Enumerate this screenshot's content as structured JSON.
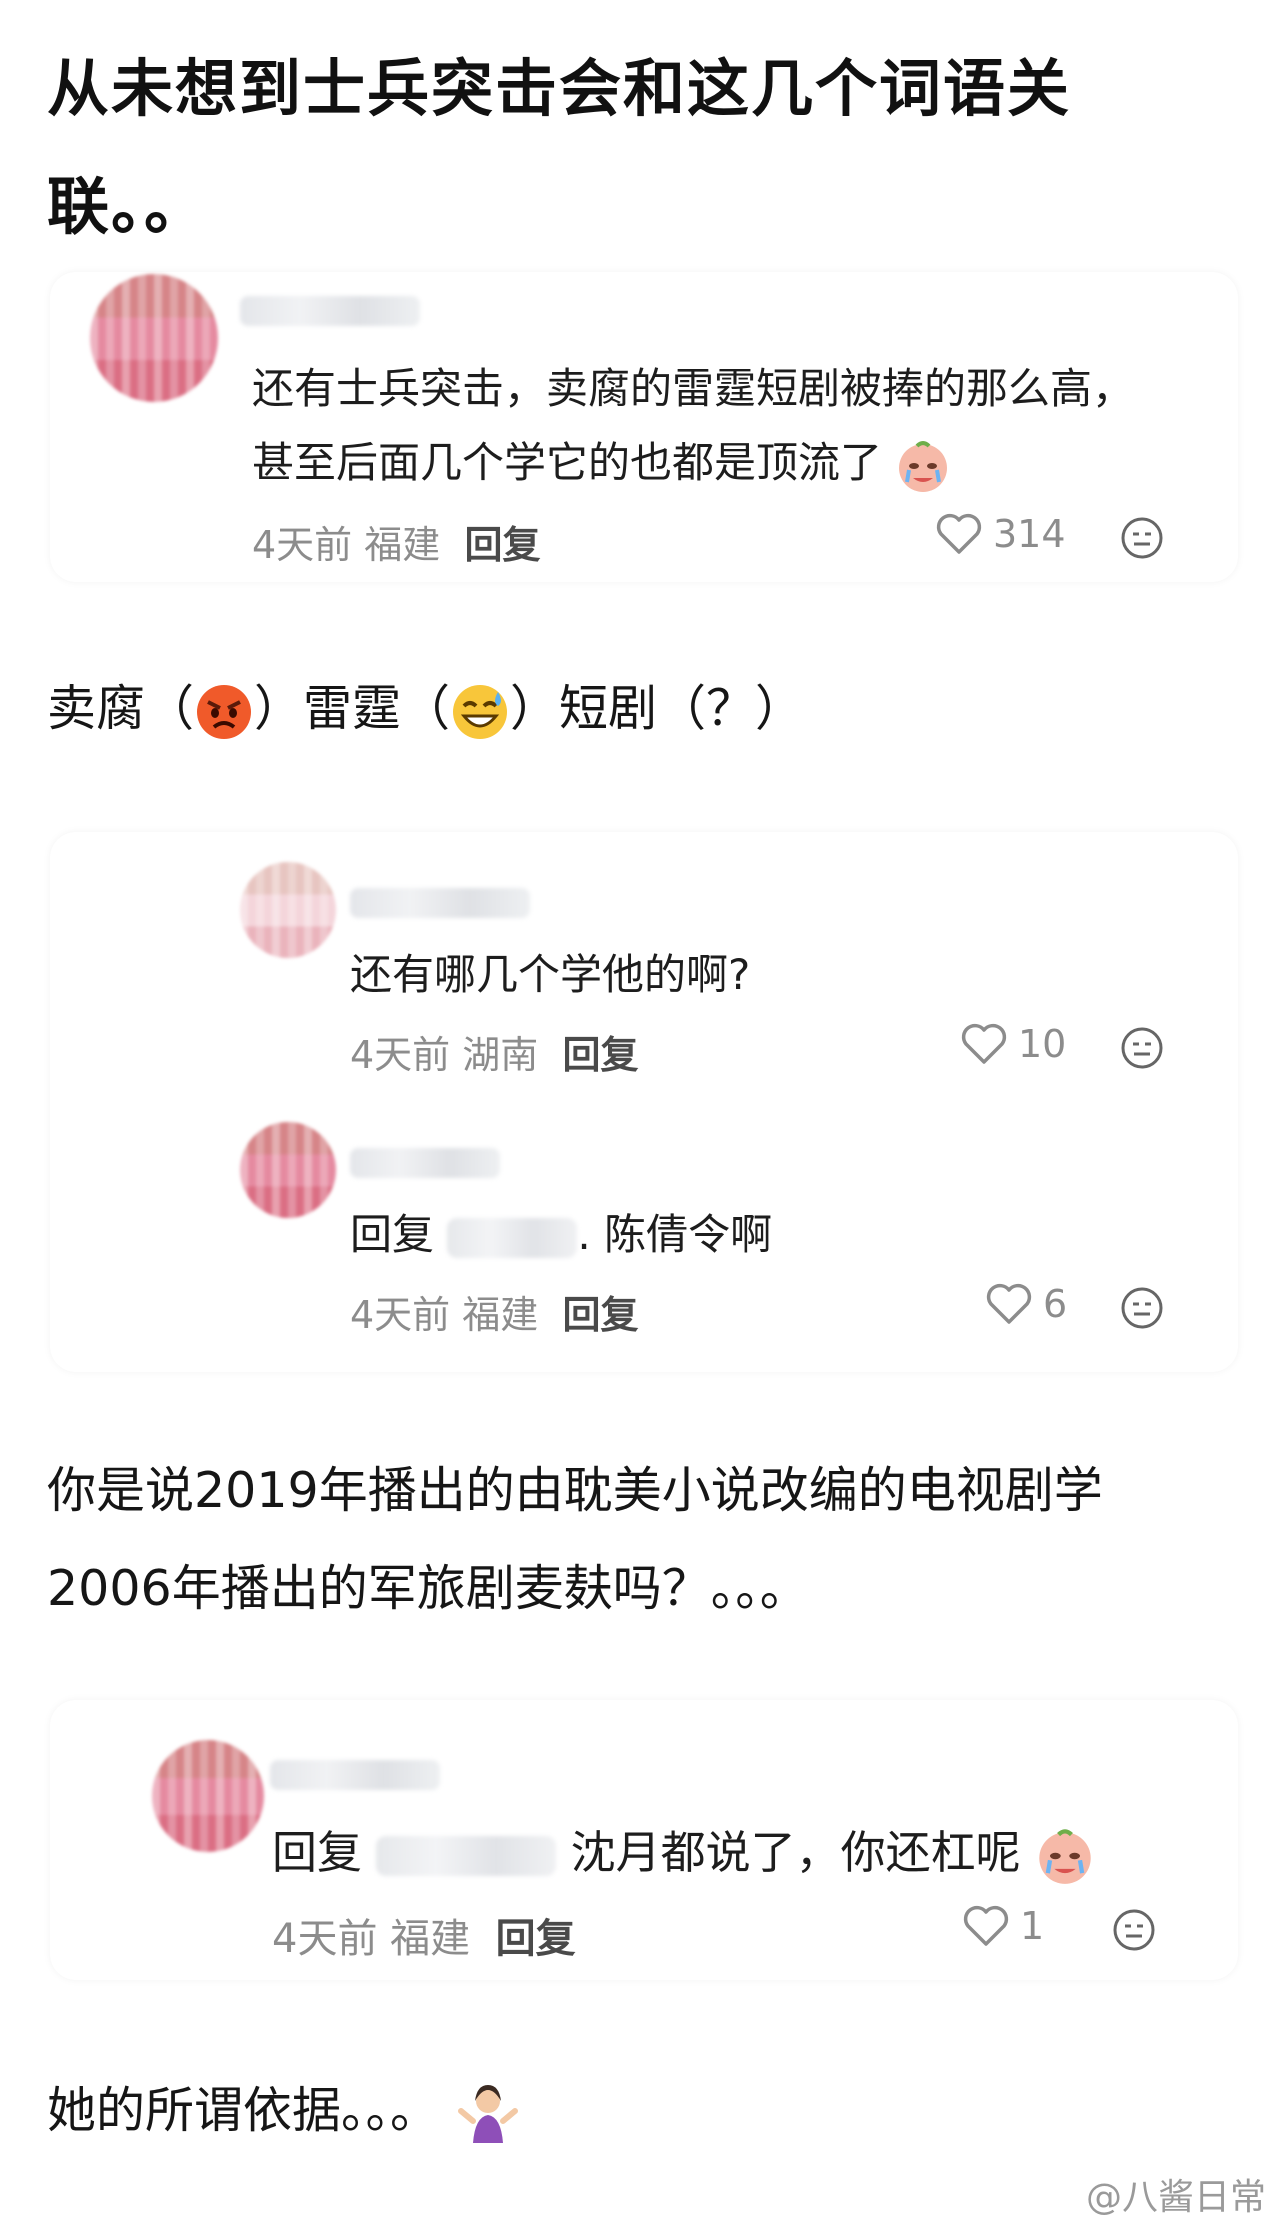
{
  "post": {
    "title": "从未想到士兵突击会和这几个词语关联。。",
    "line1_parts": [
      "卖腐（",
      "）雷霆（",
      "）短剧（？）"
    ],
    "line1_emoji": [
      "angry-face",
      "grinning-sweat-face"
    ],
    "para2": "你是说2019年播出的由耽美小说改编的电视剧学2006年播出的军旅剧麦麸吗？。。。",
    "para3": "她的所谓依据。。。"
  },
  "comments": [
    {
      "text": "还有士兵突击，卖腐的雷霆短剧被捧的那么高，甚至后面几个学它的也都是顶流了",
      "time": "4天前",
      "location": "福建",
      "reply_label": "回复",
      "likes": "314"
    },
    {
      "text": "还有哪几个学他的啊?",
      "time": "4天前",
      "location": "湖南",
      "reply_label": "回复",
      "likes": "10"
    },
    {
      "reply_prefix": "回复",
      "text": "陈倩令啊",
      "time": "4天前",
      "location": "福建",
      "reply_label": "回复",
      "likes": "6"
    },
    {
      "reply_prefix": "回复",
      "text": "沈月都说了，你还杠呢",
      "time": "4天前",
      "location": "福建",
      "reply_label": "回复",
      "likes": "1"
    }
  ],
  "watermark": "@八酱日常",
  "icons": {
    "like": "heart-outline-icon",
    "dislike": "neutral-face-icon",
    "emoji_crying": "crying-face-icon",
    "emoji_shrug": "woman-shrugging-icon"
  }
}
